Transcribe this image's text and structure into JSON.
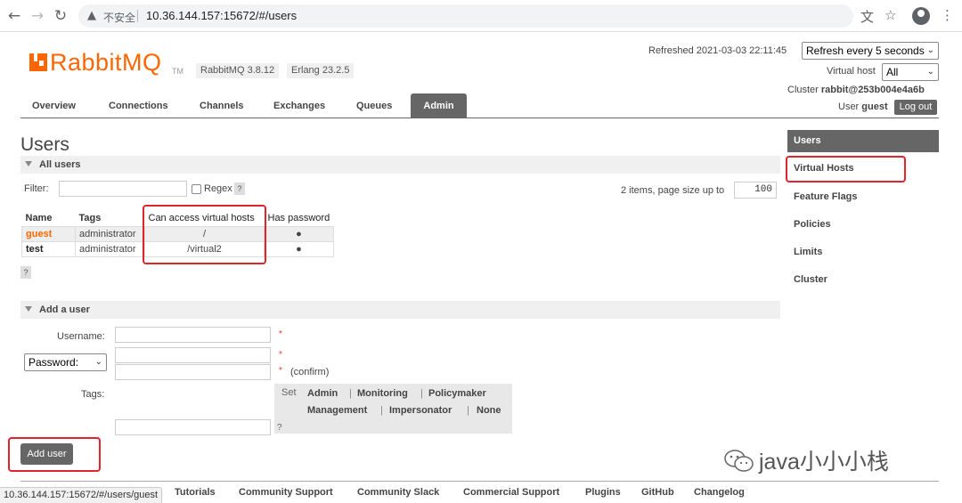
{
  "browser": {
    "insecure_label": "不安全",
    "url": "10.36.144.157:15672/#/users",
    "status_url": "10.36.144.157:15672/#/users/guest"
  },
  "brand": {
    "name": "RabbitMQ",
    "tm": "TM",
    "version": "RabbitMQ 3.8.12",
    "erlang": "Erlang 23.2.5",
    "color": "#ff6600"
  },
  "header": {
    "refreshed": "Refreshed 2021-03-03 22:11:45",
    "refresh_option": "Refresh every 5 seconds",
    "vhost_label": "Virtual host",
    "vhost_value": "All",
    "cluster_label": "Cluster",
    "cluster_value": "rabbit@253b004e4a6b",
    "user_label": "User",
    "user_value": "guest",
    "logout": "Log out"
  },
  "tabs": [
    "Overview",
    "Connections",
    "Channels",
    "Exchanges",
    "Queues",
    "Admin"
  ],
  "page": {
    "title": "Users",
    "all_users": "All users",
    "filter_label": "Filter:",
    "regex_label": "Regex",
    "help": "?",
    "page_info": "2 items, page size up to",
    "page_size": "100"
  },
  "table": {
    "headers": [
      "Name",
      "Tags",
      "Can access virtual hosts",
      "Has password"
    ],
    "rows": [
      {
        "name": "guest",
        "tags": "administrator",
        "vhosts": "/",
        "has_password": "●"
      },
      {
        "name": "test",
        "tags": "administrator",
        "vhosts": "/virtual2",
        "has_password": "●"
      }
    ]
  },
  "add_user": {
    "section": "Add a user",
    "username_label": "Username:",
    "password_option": "Password:",
    "required": "*",
    "confirm": "(confirm)",
    "tags_label": "Tags:",
    "set_label": "Set",
    "tags_row1": [
      "Admin",
      "Monitoring",
      "Policymaker"
    ],
    "tags_row2": [
      "Management",
      "Impersonator",
      "None"
    ],
    "separator": "|",
    "help": "?",
    "button": "Add user"
  },
  "right_menu": {
    "active": "Users",
    "items": [
      "Virtual Hosts",
      "Feature Flags",
      "Policies",
      "Limits",
      "Cluster"
    ]
  },
  "footer": {
    "links": [
      "Tutorials",
      "Community Support",
      "Community Slack",
      "Commercial Support",
      "Plugins",
      "GitHub",
      "Changelog"
    ]
  },
  "watermark": "java小小小栈"
}
